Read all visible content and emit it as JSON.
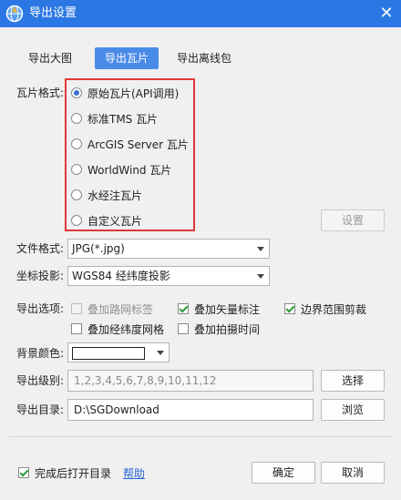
{
  "window": {
    "title": "导出设置",
    "close_glyph": "✕"
  },
  "tabs": [
    {
      "label": "导出大图",
      "active": false
    },
    {
      "label": "导出瓦片",
      "active": true
    },
    {
      "label": "导出离线包",
      "active": false
    }
  ],
  "tile_format": {
    "label": "瓦片格式:",
    "options": [
      "原始瓦片(API调用)",
      "标准TMS 瓦片",
      "ArcGIS Server 瓦片",
      "WorldWind 瓦片",
      "水经注瓦片",
      "自定义瓦片"
    ],
    "selected": "原始瓦片(API调用)",
    "settings_button": "设置"
  },
  "file_format": {
    "label": "文件格式:",
    "value": "JPG(*.jpg)"
  },
  "projection": {
    "label": "坐标投影:",
    "value": "WGS84 经纬度投影"
  },
  "export_options": {
    "label": "导出选项:",
    "items": [
      {
        "label": "叠加路网标签",
        "checked": false,
        "enabled": false
      },
      {
        "label": "叠加矢量标注",
        "checked": true,
        "enabled": true
      },
      {
        "label": "边界范围剪裁",
        "checked": true,
        "enabled": true
      },
      {
        "label": "叠加经纬度网格",
        "checked": false,
        "enabled": true
      },
      {
        "label": "叠加拍摄时间",
        "checked": false,
        "enabled": true
      }
    ]
  },
  "background_color": {
    "label": "背景颜色:",
    "value": "#ffffff"
  },
  "export_level": {
    "label": "导出级别:",
    "value": "1,2,3,4,5,6,7,8,9,10,11,12",
    "button": "选择"
  },
  "export_dir": {
    "label": "导出目录:",
    "value": "D:\\SGDownload",
    "button": "浏览"
  },
  "footer": {
    "open_dir_label": "完成后打开目录",
    "open_dir_checked": true,
    "help_link": "帮助",
    "ok": "确定",
    "cancel": "取消"
  },
  "colors": {
    "titlebar": "#2b78e4",
    "accent": "#4a8be8",
    "highlight": "#e03838"
  }
}
